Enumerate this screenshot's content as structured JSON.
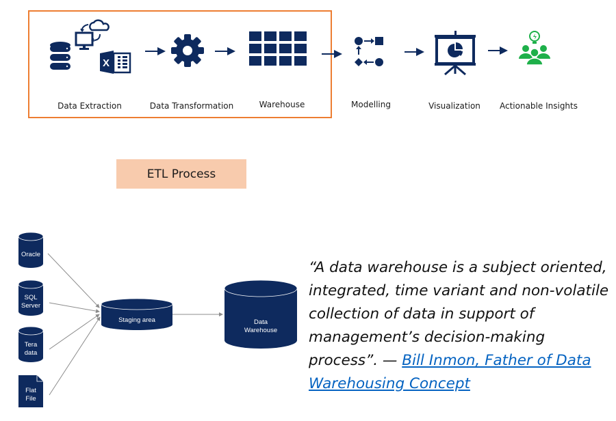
{
  "top_flow": {
    "stages": [
      {
        "label": "Data Extraction",
        "icon": "data-sources-icon"
      },
      {
        "label": "Data Transformation",
        "icon": "gear-icon"
      },
      {
        "label": "Warehouse",
        "icon": "grid-icon"
      },
      {
        "label": "Modelling",
        "icon": "modelling-icon"
      },
      {
        "label": "Visualization",
        "icon": "presentation-chart-icon"
      },
      {
        "label": "Actionable Insights",
        "icon": "insights-people-icon"
      }
    ],
    "etl_label": "ETL Process"
  },
  "colors": {
    "navy": "#0E2A5E",
    "orange_border": "#ED7D31",
    "etl_fill": "#F8CBAD",
    "insight_green": "#1EB04A",
    "link_blue": "#0563C1",
    "connector_gray": "#8C8C8C"
  },
  "bottom_diagram": {
    "sources": [
      {
        "label_lines": [
          "Oracle"
        ],
        "shape": "cylinder"
      },
      {
        "label_lines": [
          "SQL",
          "Server"
        ],
        "shape": "cylinder"
      },
      {
        "label_lines": [
          "Tera",
          "data"
        ],
        "shape": "cylinder"
      },
      {
        "label_lines": [
          "Flat",
          "File"
        ],
        "shape": "document"
      }
    ],
    "staging": {
      "label": "Staging area"
    },
    "warehouse": {
      "label_lines": [
        "Data",
        "Warehouse"
      ]
    }
  },
  "quote": {
    "text": "“A data warehouse is a subject oriented, integrated, time variant and non-volatile collection of data in support of management’s decision-making process”. — ",
    "link_text": "Bill Inmon, Father of Data Warehousing Concept"
  }
}
